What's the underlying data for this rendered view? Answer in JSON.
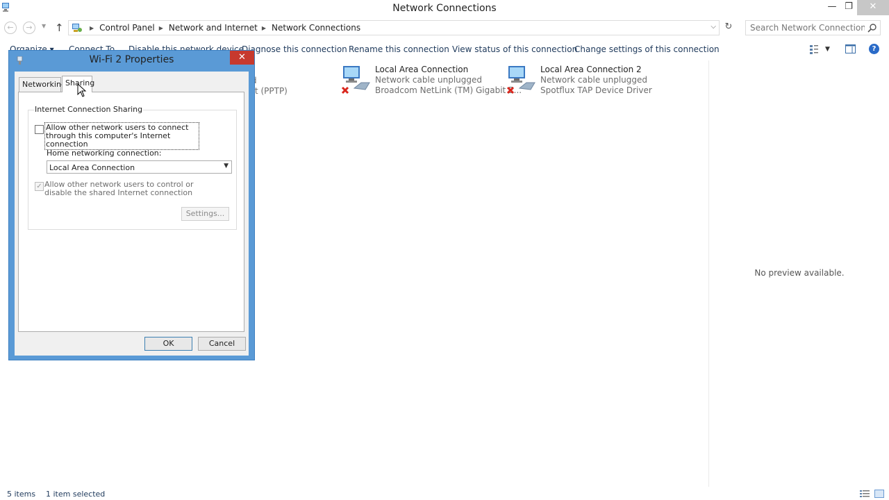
{
  "window": {
    "title": "Network Connections",
    "controls": {
      "minimize": "—",
      "maximize": "❐",
      "close": "✕"
    }
  },
  "address": {
    "crumbs": [
      "Control Panel",
      "Network and Internet",
      "Network Connections"
    ],
    "search_placeholder": "Search Network Connections"
  },
  "commands": {
    "organize": "Organize ▾",
    "connect_to": "Connect To",
    "disable": "Disable this network device",
    "diagnose": "Diagnose this connection",
    "rename": "Rename this connection",
    "view_status": "View status of this connection",
    "change_settings": "Change settings of this connection"
  },
  "connections": [
    {
      "name": "Local Area Connection",
      "status": "Network cable unplugged",
      "device": "Broadcom NetLink (TM) Gigabit E..."
    },
    {
      "name": "Local Area Connection 2",
      "status": "Network cable unplugged",
      "device": "Spotflux TAP Device Driver"
    }
  ],
  "partial_item": {
    "line1": "d",
    "line2": "rt (PPTP)"
  },
  "preview": {
    "text": "No preview available."
  },
  "status_bar": {
    "items": "5 items",
    "selected": "1 item selected"
  },
  "dialog": {
    "title": "Wi-Fi 2 Properties",
    "tabs": {
      "networking": "Networking",
      "sharing": "Sharing"
    },
    "group_title": "Internet Connection Sharing",
    "allow_connect": "Allow other network users to connect through this computer's Internet connection",
    "allow_connect_checked": false,
    "home_label": "Home networking connection:",
    "home_value": "Local Area Connection",
    "allow_control": "Allow other network users to control or disable the shared Internet connection",
    "allow_control_checked": true,
    "settings_btn": "Settings...",
    "ok": "OK",
    "cancel": "Cancel"
  },
  "colors": {
    "accent": "#5a9ad6",
    "close_red": "#c7392d",
    "link_blue": "#1e395b"
  }
}
